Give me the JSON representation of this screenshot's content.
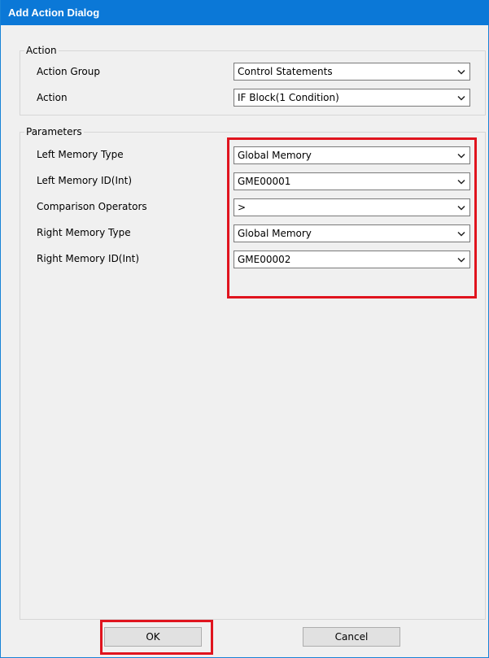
{
  "window": {
    "title": "Add Action Dialog"
  },
  "action_group_box": {
    "legend": "Action",
    "fields": [
      {
        "label": "Action Group",
        "value": "Control Statements"
      },
      {
        "label": "Action",
        "value": "IF Block(1 Condition)"
      }
    ]
  },
  "parameters_box": {
    "legend": "Parameters",
    "fields": [
      {
        "label": "Left Memory Type",
        "value": "Global Memory"
      },
      {
        "label": "Left Memory ID(Int)",
        "value": "GME00001"
      },
      {
        "label": "Comparison Operators",
        "value": ">"
      },
      {
        "label": "Right Memory Type",
        "value": "Global Memory"
      },
      {
        "label": "Right Memory ID(Int)",
        "value": "GME00002"
      }
    ]
  },
  "buttons": {
    "ok_label": "OK",
    "cancel_label": "Cancel"
  },
  "icons": {
    "dropdown": "chevron-down-icon"
  },
  "colors": {
    "titlebar": "#0b78d7",
    "highlight": "#e0141e",
    "dialog_background": "#f0f0f0"
  }
}
